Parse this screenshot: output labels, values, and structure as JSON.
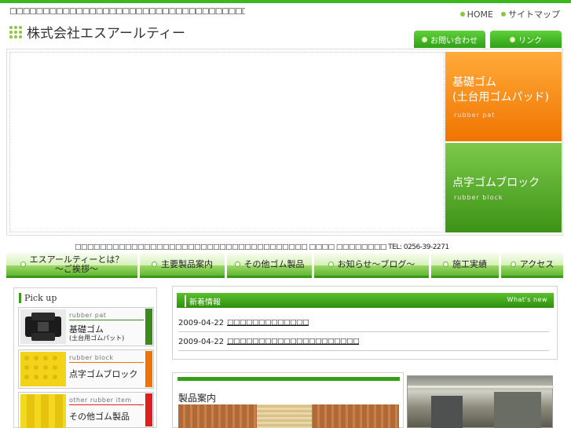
{
  "header": {
    "tagline": "□□□□□□□□□□□□□□□□□□□□□□□□□□□□□□□□□□□□□□□□ □□□□□□□",
    "company_name": "株式会社エスアールティー",
    "top_links": [
      {
        "label": "HOME"
      },
      {
        "label": "サイトマップ"
      }
    ],
    "tab_buttons": [
      {
        "label": "お問い合わせ"
      },
      {
        "label": "リンク"
      }
    ]
  },
  "hero": {
    "side_blocks": [
      {
        "title_line1": "基礎ゴム",
        "title_line2": "(土台用ゴムパッド)",
        "subtitle": "rubber pat",
        "color": "#f07400"
      },
      {
        "title_line1": "点字ゴムブロック",
        "title_line2": "",
        "subtitle": "rubber block",
        "color": "#3c9316"
      }
    ]
  },
  "info_line": "□□□□□□□□□□□□□□□□□□□□□□□□□□□□□□□□□□□□□ □□□□ □□□□□□□□ TEL: 0256-39-2271",
  "global_nav": [
    {
      "label_line1": "エスアールティーとは？",
      "label_line2": "〜ご挨拶〜"
    },
    {
      "label_line1": "主要製品案内",
      "label_line2": ""
    },
    {
      "label_line1": "その他ゴム製品",
      "label_line2": ""
    },
    {
      "label_line1": "お知らせ〜ブログ〜",
      "label_line2": ""
    },
    {
      "label_line1": "施工実績",
      "label_line2": ""
    },
    {
      "label_line1": "アクセス",
      "label_line2": ""
    }
  ],
  "pickup": {
    "heading": "Pick up",
    "items": [
      {
        "subtitle": "rubber pat",
        "title": "基礎ゴム",
        "title2": "(土台用ゴムパット)",
        "bar_color": "#3c8a1c"
      },
      {
        "subtitle": "rubber block",
        "title": "点字ゴムブロック",
        "title2": "",
        "bar_color": "#f07400"
      },
      {
        "subtitle": "other rubber item",
        "title": "その他ゴム製品",
        "title2": "",
        "bar_color": "#e21d1d"
      }
    ]
  },
  "news": {
    "heading": "新着情報",
    "heading_en": "What's new",
    "items": [
      {
        "date": "2009-04-22",
        "title": "□□□□□□□□□□□□□"
      },
      {
        "date": "2009-04-22",
        "title": "□□□□□□□□□□□□□□□□□□□□□"
      }
    ]
  },
  "products": {
    "heading": "製品案内"
  }
}
